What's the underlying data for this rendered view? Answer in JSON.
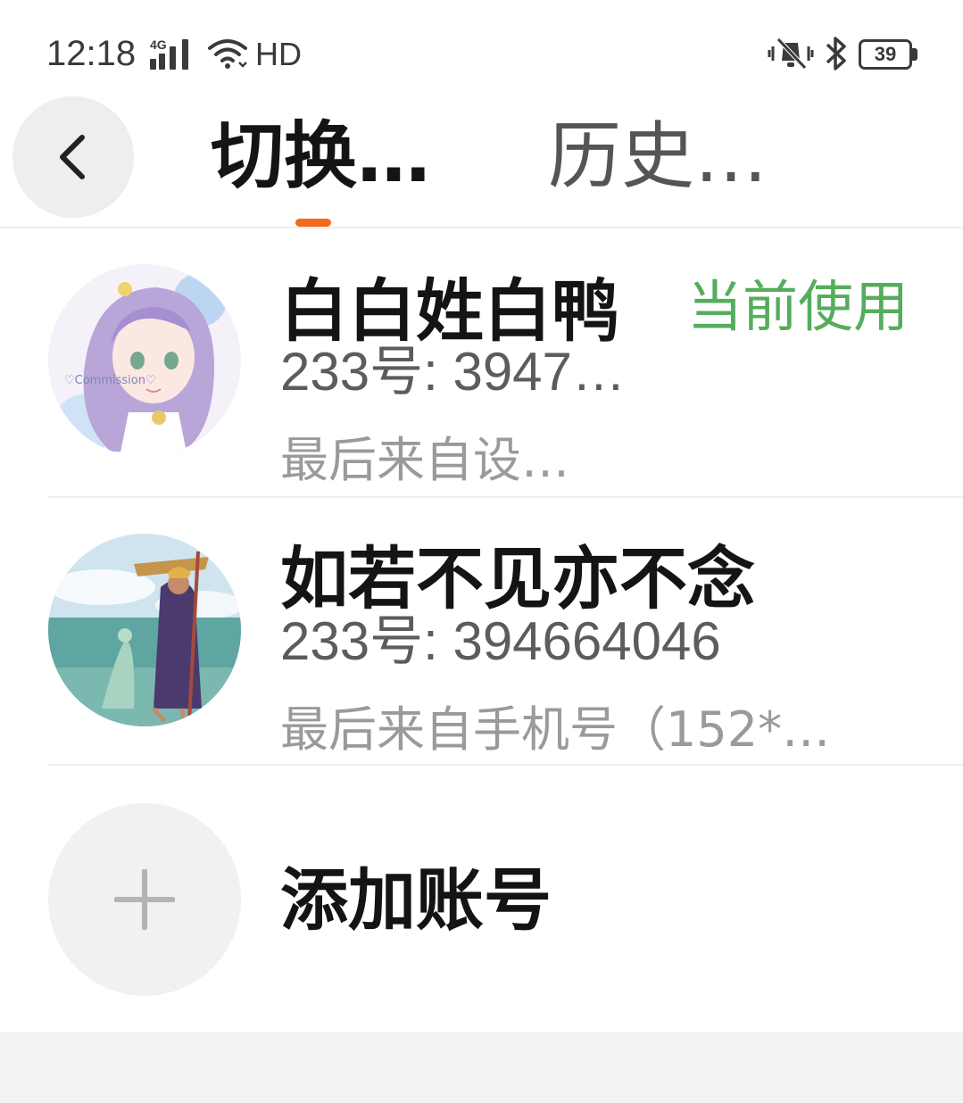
{
  "status_bar": {
    "time": "12:18",
    "network_type": "4G",
    "hd_label": "HD",
    "battery_level": "39",
    "icons": [
      "signal-icon",
      "wifi-icon",
      "mute-icon",
      "bluetooth-icon",
      "battery-icon"
    ]
  },
  "header": {
    "back_icon": "chevron-left-icon",
    "tabs": [
      {
        "label": "切换…",
        "active": true
      },
      {
        "label": "历史…",
        "active": false
      }
    ],
    "accent_color": "#f26a1b"
  },
  "accounts": [
    {
      "name": "白白姓白鸭",
      "uid": "233号: 3947…",
      "source": "最后来自设…",
      "current_label": "当前使用"
    },
    {
      "name": "如若不见亦不念",
      "uid": "233号: 394664046",
      "source": "最后来自手机号（152*…"
    }
  ],
  "add_account": {
    "label": "添加账号",
    "icon": "plus-icon"
  },
  "colors": {
    "current_badge": "#55ad5c",
    "title_text": "#141414",
    "secondary_text": "#5c5c5c",
    "tertiary_text": "#9a9a9a"
  }
}
